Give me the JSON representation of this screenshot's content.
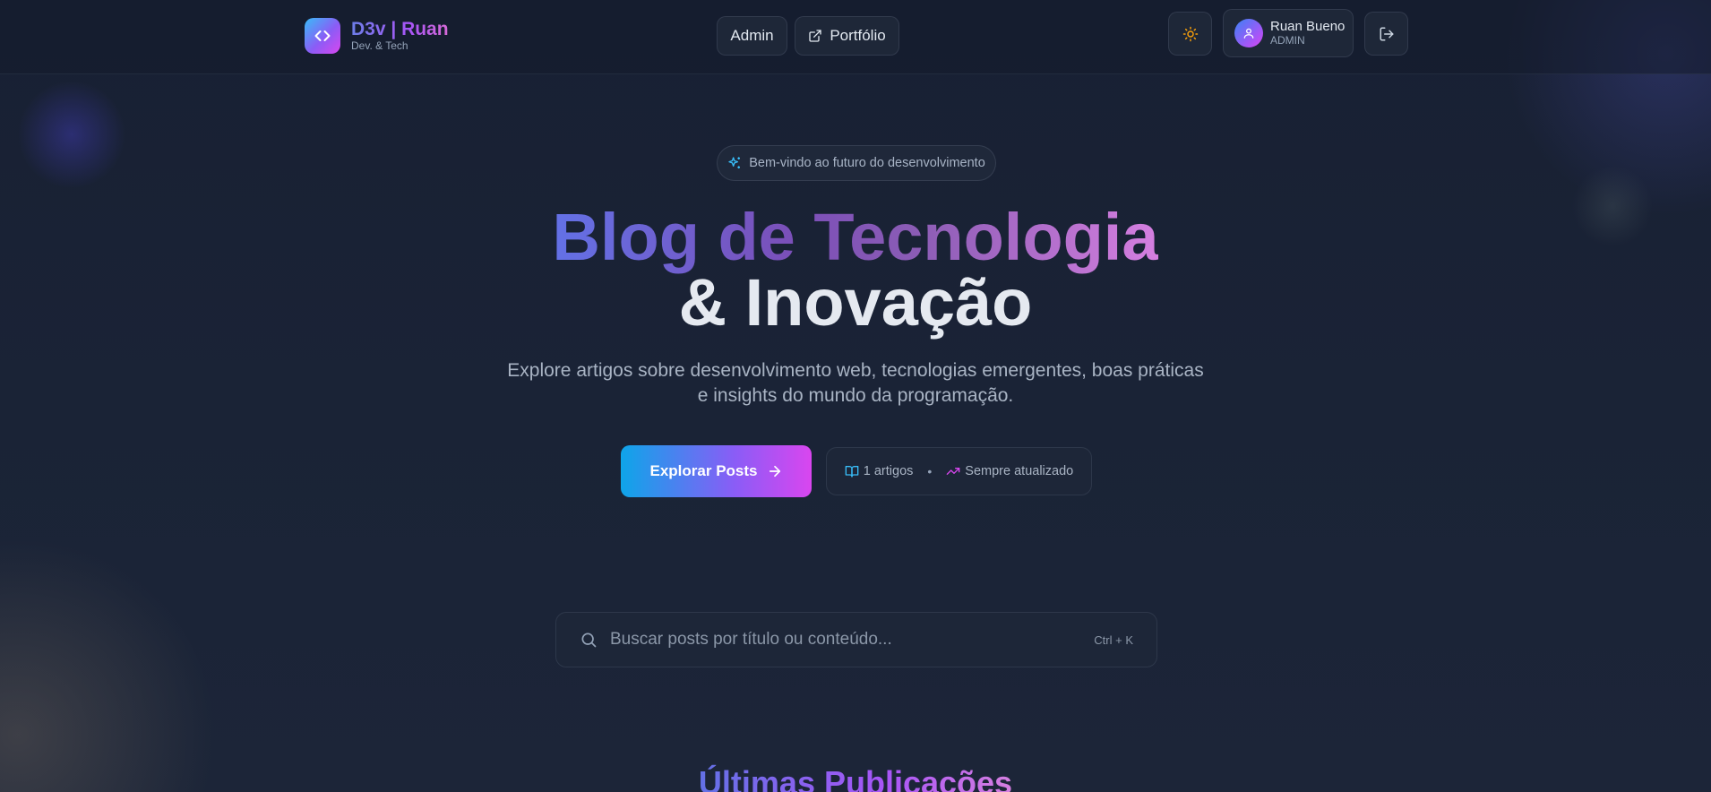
{
  "brand": {
    "title": "D3v | Ruan",
    "subtitle": "Dev. & Tech",
    "icon": "code-icon"
  },
  "nav": {
    "admin_label": "Admin",
    "portfolio_label": "Portfólio",
    "portfolio_icon": "external-link-icon"
  },
  "toolbar": {
    "theme_icon": "sun-icon",
    "logout_icon": "logout-icon"
  },
  "user": {
    "name": "Ruan Bueno",
    "role": "ADMIN",
    "avatar_icon": "user-icon"
  },
  "hero": {
    "badge_text": "Bem-vindo ao futuro do desenvolvimento",
    "title_line1": "Blog de Tecnologia",
    "title_line2": "& Inovação",
    "description": "Explore artigos sobre desenvolvimento web, tecnologias emergentes, boas práticas e insights do mundo da programação.",
    "cta_label": "Explorar Posts",
    "stats_articles": "1 artigos",
    "stats_updated": "Sempre atualizado"
  },
  "search": {
    "placeholder": "Buscar posts por título ou conteúdo...",
    "value": "",
    "shortcut": "Ctrl + K"
  },
  "section": {
    "title": "Últimas Publicações"
  },
  "colors": {
    "background": "#172032",
    "accent_blue": "#0ea5e9",
    "accent_violet": "#8b5cf6",
    "accent_pink": "#d946ef",
    "sun_icon": "#f59e0b"
  }
}
